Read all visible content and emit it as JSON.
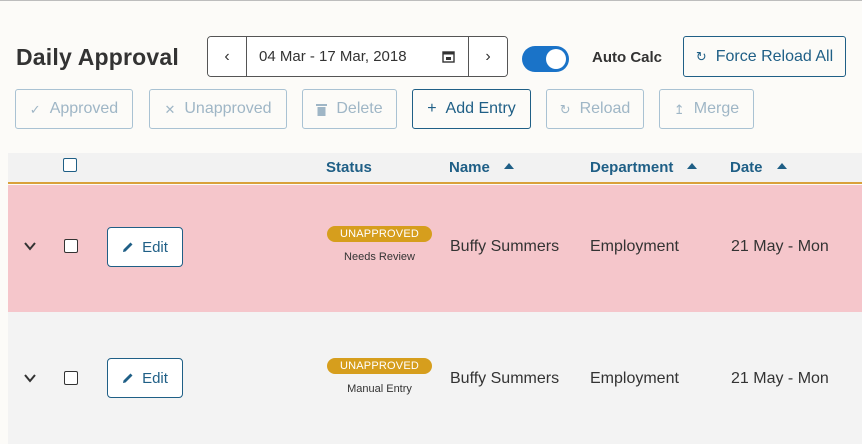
{
  "header": {
    "title": "Daily Approval",
    "date_range": "04 Mar - 17 Mar, 2018",
    "prev_glyph": "‹",
    "next_glyph": "›",
    "auto_calc_label": "Auto Calc",
    "auto_calc_on": true,
    "force_reload_label": "Force Reload All"
  },
  "toolbar": {
    "approved_label": "Approved",
    "unapproved_label": "Unapproved",
    "delete_label": "Delete",
    "add_entry_label": "Add Entry",
    "reload_label": "Reload",
    "merge_label": "Merge"
  },
  "table": {
    "columns": {
      "status": "Status",
      "name": "Name",
      "department": "Department",
      "date": "Date"
    },
    "rows": [
      {
        "edit_label": "Edit",
        "status": "UNAPPROVED",
        "status_note": "Needs Review",
        "name": "Buffy Summers",
        "department": "Employment",
        "date": "21 May - Mon",
        "highlight": "#f5c6cb"
      },
      {
        "edit_label": "Edit",
        "status": "UNAPPROVED",
        "status_note": "Manual Entry",
        "name": "Buffy Summers",
        "department": "Employment",
        "date": "21 May - Mon",
        "highlight": "#f3f3f3"
      }
    ]
  },
  "colors": {
    "accent": "#1f5f86",
    "toggle": "#1a73c8",
    "badge": "#d69e1d",
    "header_underline": "#d9a13a"
  },
  "icons": [
    "chevron-left-icon",
    "chevron-right-icon",
    "calendar-icon",
    "reload-icon",
    "check-icon",
    "close-icon",
    "trash-icon",
    "plus-icon",
    "merge-icon",
    "sort-up-icon",
    "chevron-down-icon",
    "pencil-icon"
  ]
}
